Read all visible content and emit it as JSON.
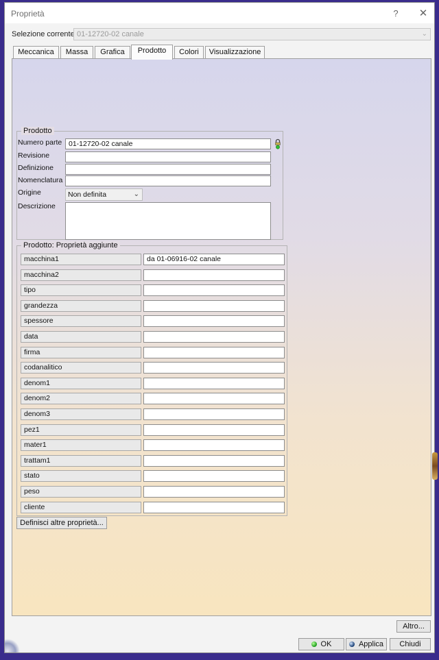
{
  "window": {
    "title": "Proprietà",
    "help_glyph": "?",
    "close_glyph": "✕"
  },
  "selection": {
    "label": "Selezione corrente:",
    "value": "01-12720-02 canale"
  },
  "tabs": [
    {
      "label": "Meccanica"
    },
    {
      "label": "Massa"
    },
    {
      "label": "Grafica"
    },
    {
      "label": "Prodotto",
      "active": true
    },
    {
      "label": "Colori"
    },
    {
      "label": "Visualizzazione"
    }
  ],
  "product": {
    "title": "Prodotto",
    "fields": {
      "numero_parte": {
        "label": "Numero parte",
        "value": "01-12720-02 canale"
      },
      "revisione": {
        "label": "Revisione",
        "value": ""
      },
      "definizione": {
        "label": "Definizione",
        "value": ""
      },
      "nomenclatura": {
        "label": "Nomenclatura",
        "value": ""
      },
      "origine": {
        "label": "Origine",
        "value": "Non definita"
      },
      "descrizione": {
        "label": "Descrizione",
        "value": ""
      }
    },
    "lock_icon": "padlock-icon"
  },
  "properties": {
    "title": "Prodotto: Proprietà aggiunte",
    "rows": [
      {
        "name": "macchina1",
        "value": "da 01-06916-02 canale"
      },
      {
        "name": "macchina2",
        "value": ""
      },
      {
        "name": "tipo",
        "value": ""
      },
      {
        "name": "grandezza",
        "value": ""
      },
      {
        "name": "spessore",
        "value": ""
      },
      {
        "name": "data",
        "value": ""
      },
      {
        "name": "firma",
        "value": ""
      },
      {
        "name": "codanalitico",
        "value": ""
      },
      {
        "name": "denom1",
        "value": ""
      },
      {
        "name": "denom2",
        "value": ""
      },
      {
        "name": "denom3",
        "value": ""
      },
      {
        "name": "pez1",
        "value": ""
      },
      {
        "name": "mater1",
        "value": ""
      },
      {
        "name": "trattam1",
        "value": ""
      },
      {
        "name": "stato",
        "value": ""
      },
      {
        "name": "peso",
        "value": ""
      },
      {
        "name": "cliente",
        "value": ""
      }
    ],
    "define_button": "Definisci altre proprietà..."
  },
  "buttons": {
    "altro": "Altro...",
    "ok": "OK",
    "applica": "Applica",
    "chiudi": "Chiudi"
  },
  "colors": {
    "accent_green": "#1a9a1a",
    "accent_blue": "#153a70"
  }
}
